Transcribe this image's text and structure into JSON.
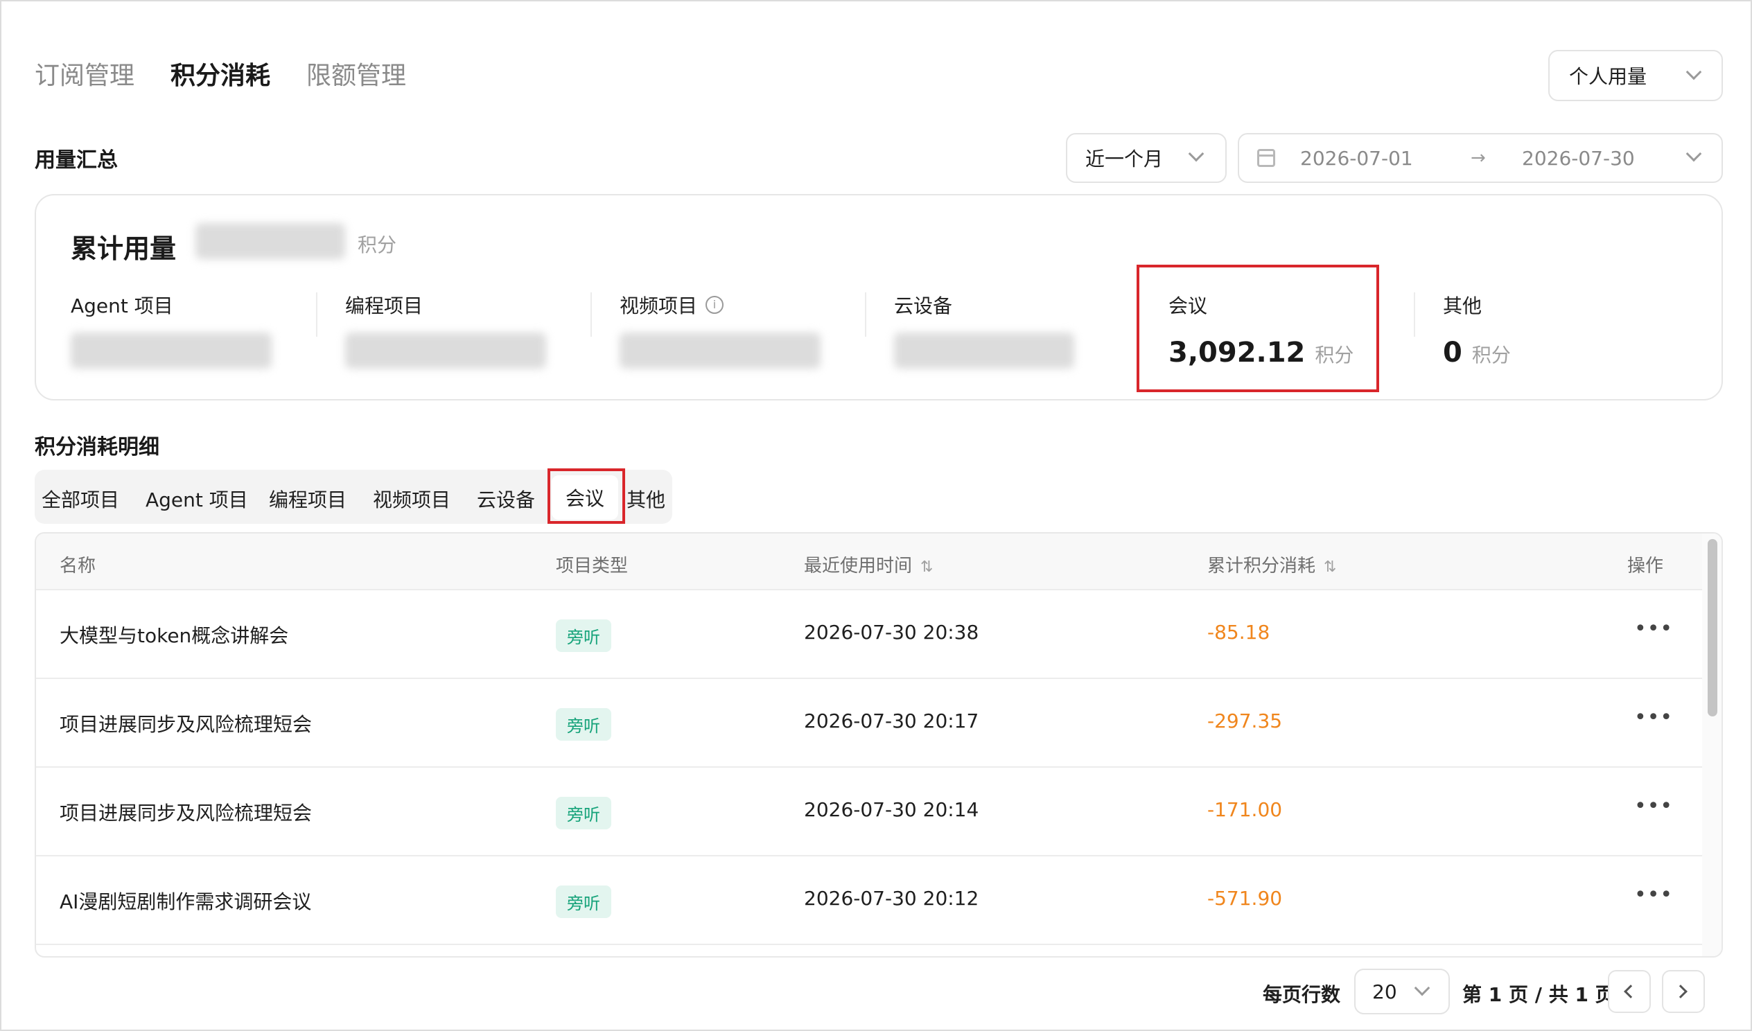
{
  "top_tabs": [
    {
      "label": "订阅管理",
      "active": false
    },
    {
      "label": "积分消耗",
      "active": true
    },
    {
      "label": "限额管理",
      "active": false
    }
  ],
  "usage_scope": {
    "selected": "个人用量"
  },
  "summary": {
    "title": "用量汇总",
    "period": "近一个月",
    "date_start": "2026-07-01",
    "date_end": "2026-07-30",
    "total_label": "累计用量",
    "unit": "积分",
    "metrics": [
      {
        "label": "Agent 项目"
      },
      {
        "label": "编程项目"
      },
      {
        "label": "视频项目"
      },
      {
        "label": "云设备"
      },
      {
        "label": "会议",
        "value": "3,092.12",
        "unit": "积分"
      },
      {
        "label": "其他",
        "value": "0",
        "unit": "积分"
      }
    ]
  },
  "detail": {
    "title": "积分消耗明细",
    "tabs": [
      "全部项目",
      "Agent 项目",
      "编程项目",
      "视频项目",
      "云设备",
      "会议",
      "其他"
    ],
    "active_tab": "会议",
    "columns": {
      "name": "名称",
      "type": "项目类型",
      "last_used": "最近使用时间",
      "total": "累计积分消耗",
      "actions": "操作"
    },
    "rows": [
      {
        "name": "大模型与token概念讲解会",
        "type": "旁听",
        "last_used": "2026-07-30 20:38",
        "total": "-85.18"
      },
      {
        "name": "项目进展同步及风险梳理短会",
        "type": "旁听",
        "last_used": "2026-07-30 20:17",
        "total": "-297.35"
      },
      {
        "name": "项目进展同步及风险梳理短会",
        "type": "旁听",
        "last_used": "2026-07-30 20:14",
        "total": "-171.00"
      },
      {
        "name": "AI漫剧短剧制作需求调研会议",
        "type": "旁听",
        "last_used": "2026-07-30 20:12",
        "total": "-571.90"
      }
    ]
  },
  "pagination": {
    "rows_per_page_label": "每页行数",
    "page_size": "20",
    "page_info": "第 1 页 / 共 1 页"
  },
  "colors": {
    "accent_red": "#d9262b",
    "amount_orange": "#f0861d",
    "tag_green": "#16a37a",
    "tag_bg": "#e3f5ef"
  },
  "icons": {
    "sort": "sort-updown-icon",
    "more": "more-horizontal-icon",
    "calendar": "calendar-icon",
    "info": "info-circle-icon"
  }
}
